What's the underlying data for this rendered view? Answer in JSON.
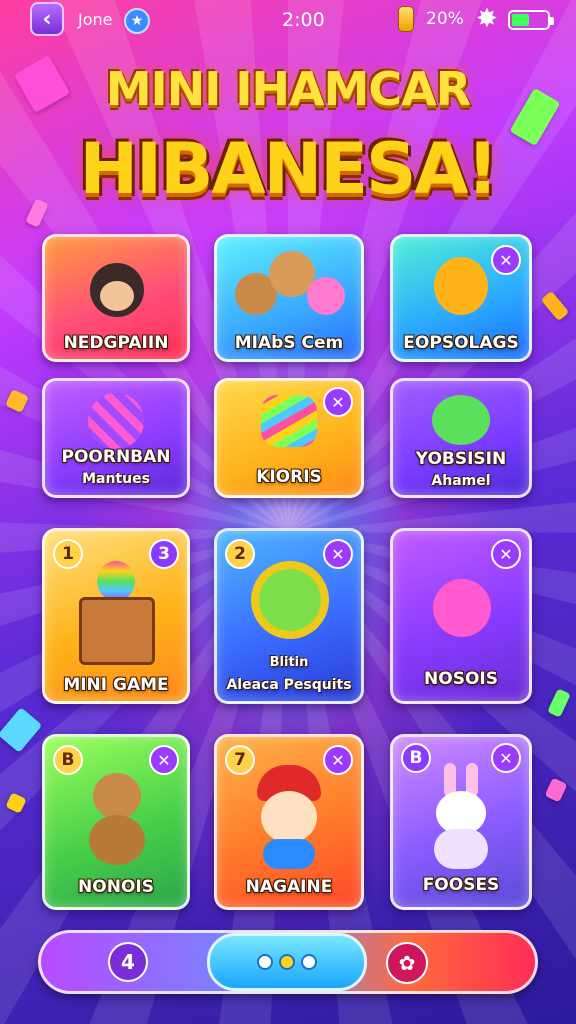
{
  "status_bar": {
    "back_icon": "chevron-left-icon",
    "user_name": "Jone",
    "verified_icon": "star-badge-icon",
    "time": "2:00",
    "coins": "20%",
    "settings_icon": "gear-icon",
    "battery_level": 0.5
  },
  "title": {
    "line1": "MINI IHAMCAR",
    "line2": "HIBANESA!"
  },
  "cards": [
    {
      "label": "NEDGPAIIN",
      "sub": "",
      "badge": "",
      "close": false,
      "icon": "monkey-icon"
    },
    {
      "label": "MIAbS Cem",
      "sub": "",
      "badge": "",
      "close": false,
      "icon": "animal-friends-icon"
    },
    {
      "label": "EOPSOLAGS",
      "sub": "",
      "badge": "",
      "close": true,
      "icon": "gummy-bear-icon"
    },
    {
      "label": "POORNBAN",
      "sub": "Mantues",
      "badge": "",
      "close": false,
      "icon": "striped-ball-icon"
    },
    {
      "label": "KIORIS",
      "sub": "",
      "badge": "",
      "close": true,
      "icon": "candy-icon"
    },
    {
      "label": "YOBSISIN",
      "sub": "Ahamel",
      "badge": "",
      "close": false,
      "icon": "green-blob-icon"
    },
    {
      "label": "MINI GAME",
      "sub": "",
      "badge": "1",
      "badge2": "3",
      "close": false,
      "icon": "rainbow-box-icon"
    },
    {
      "label": "Blitin",
      "sub": "Aleaca Pesquits",
      "badge": "2",
      "close": true,
      "icon": "green-star-icon"
    },
    {
      "label": "NOSOIS",
      "sub": "",
      "badge": "",
      "close": true,
      "icon": "pink-bear-icon"
    },
    {
      "label": "NONOIS",
      "sub": "",
      "badge": "B",
      "close": true,
      "icon": "cat-icon"
    },
    {
      "label": "NAGAINE",
      "sub": "",
      "badge": "7",
      "close": true,
      "icon": "hat-cat-icon"
    },
    {
      "label": "FOOSES",
      "sub": "",
      "badge": "B",
      "close": true,
      "icon": "bunny-icon"
    }
  ],
  "bottom_bar": {
    "left_value": "4",
    "dots": 3,
    "active_dot": 2,
    "right_icon": "gift-icon"
  },
  "colors": {
    "title": "#ffd21a",
    "badge_close": "#9b3bff",
    "badge_number": "#ffd24a"
  }
}
